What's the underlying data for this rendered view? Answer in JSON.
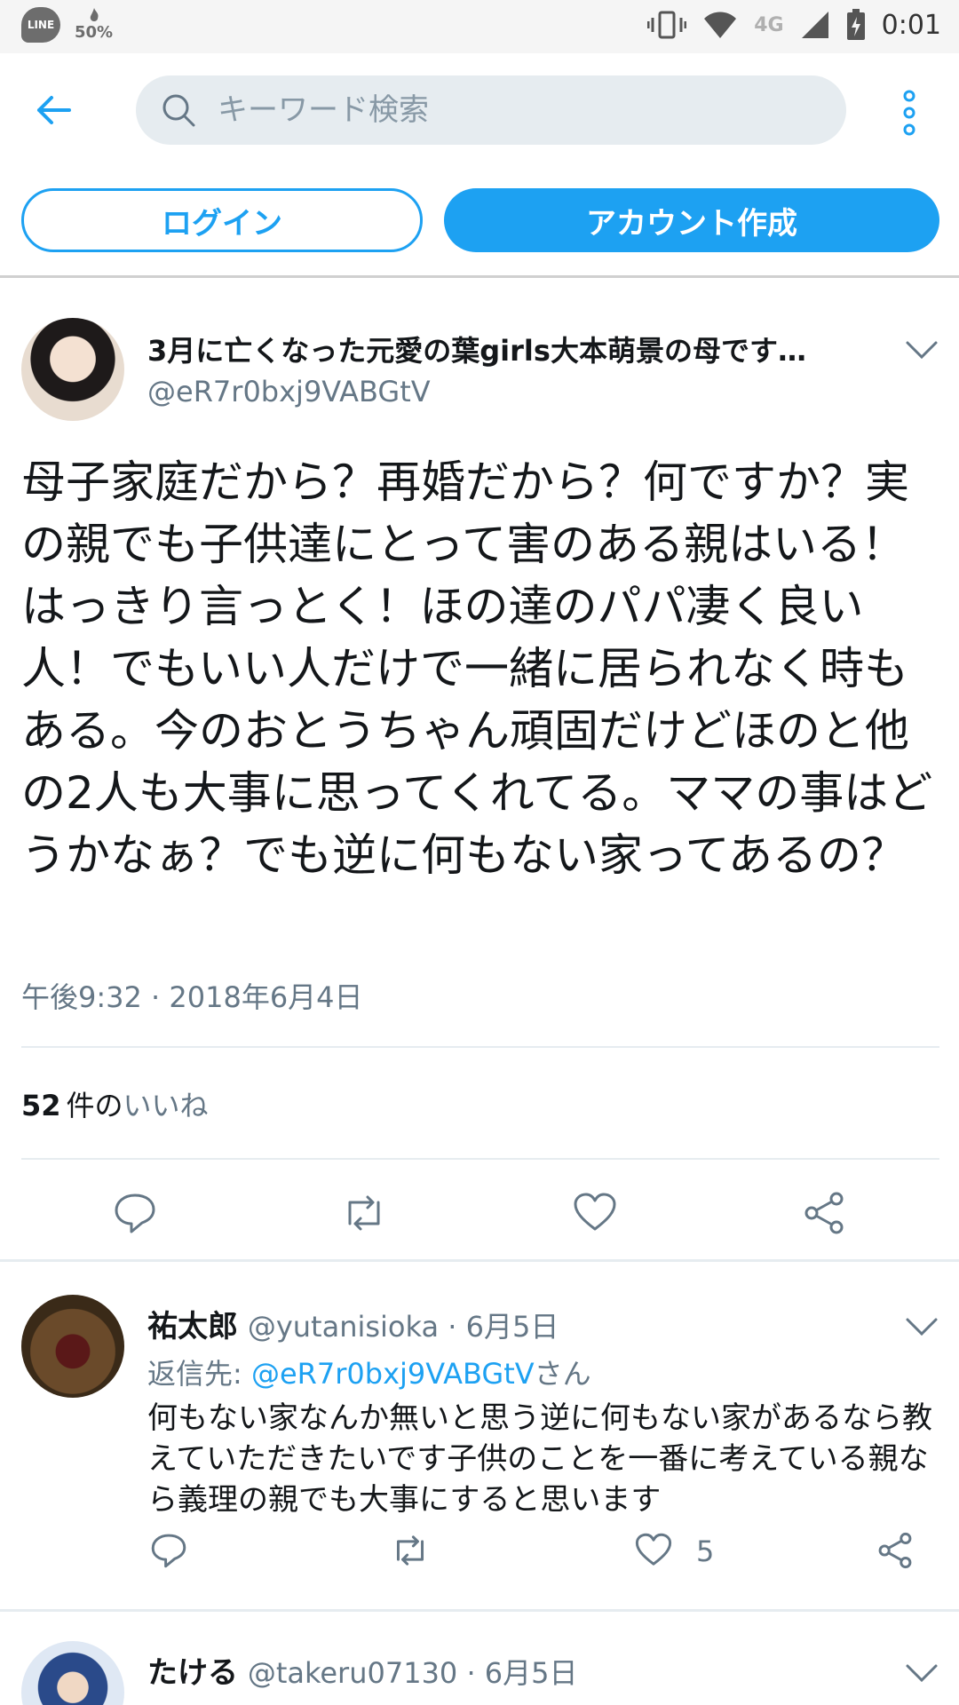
{
  "status_bar": {
    "line_label": "LINE",
    "battery_saver": "50%",
    "network": "4G",
    "time": "0:01"
  },
  "search": {
    "placeholder": "キーワード検索"
  },
  "auth": {
    "login_label": "ログイン",
    "signup_label": "アカウント作成"
  },
  "tweet": {
    "author_name": "3月に亡くなった元愛の葉girls大本萌景の母です…",
    "author_handle": "@eR7r0bxj9VABGtV",
    "text": "母子家庭だから？再婚だから？何ですか？実の親でも子供達にとって害のある親はいる！はっきり言っとく！ほの達のパパ凄く良い人！でもいい人だけで一緒に居られなく時もある。今のおとうちゃん頑固だけどほのと他の2人も大事に思ってくれてる。ママの事はどうかなぁ？でも逆に何もない家ってあるの？",
    "timestamp": "午後9:32 · 2018年6月4日",
    "likes_count": "52",
    "likes_unit": "件の",
    "likes_label": "いいね"
  },
  "replies": [
    {
      "name": "祐太郎",
      "meta": "@yutanisioka · 6月5日",
      "reply_to_prefix": "返信先: ",
      "reply_to_handle": "@eR7r0bxj9VABGtV",
      "reply_to_suffix": "さん",
      "text": "何もない家なんか無いと思う逆に何もない家があるなら教えていただきたいです子供のことを一番に考えている親なら義理の親でも大事にすると思います",
      "like_count": "5"
    },
    {
      "name": "たける",
      "meta": "@takeru07130 · 6月5日"
    }
  ],
  "colors": {
    "accent": "#1da1f2",
    "secondary_text": "#657786",
    "divider": "#e6ecf0"
  }
}
